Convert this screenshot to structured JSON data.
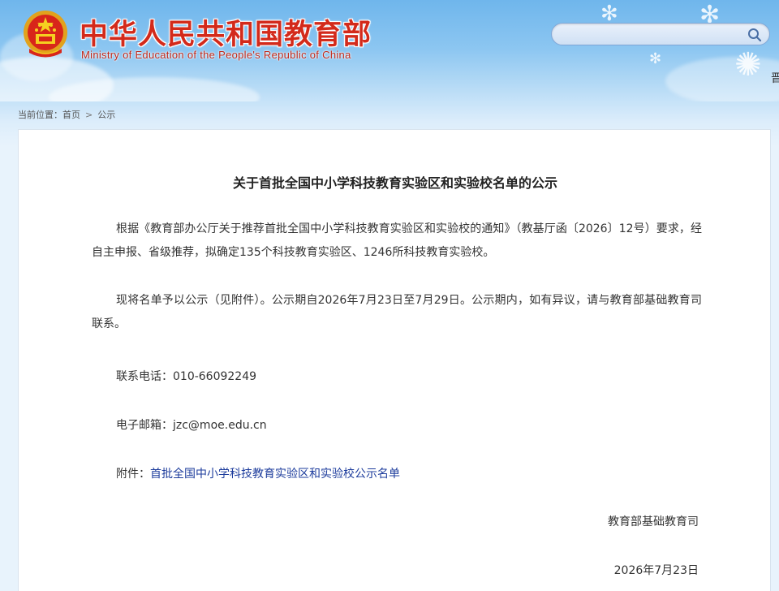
{
  "header": {
    "title_cn": "中华人民共和国教育部",
    "title_en": "Ministry of Education of the People's Republic of China",
    "search": {
      "placeholder": "",
      "value": ""
    },
    "edge_glyph": "晋"
  },
  "breadcrumb": {
    "prefix": "当前位置：",
    "items": [
      "首页",
      "公示"
    ],
    "separator": ">"
  },
  "article": {
    "title": "关于首批全国中小学科技教育实验区和实验校名单的公示",
    "paragraphs": [
      "根据《教育部办公厅关于推荐首批全国中小学科技教育实验区和实验校的通知》（教基厅函〔2026〕12号）要求，经自主申报、省级推荐，拟确定135个科技教育实验区、1246所科技教育实验校。",
      "现将名单予以公示（见附件）。公示期自2026年7月23日至7月29日。公示期内，如有异议，请与教育部基础教育司联系。"
    ],
    "contact_phone_label": "联系电话：",
    "contact_phone": "010-66092249",
    "email_label": "电子邮箱：",
    "email": "jzc@moe.edu.cn",
    "attachment_label": "附件：",
    "attachment_link": "首批全国中小学科技教育实验区和实验校公示名单",
    "signature": "教育部基础教育司",
    "date": "2026年7月23日"
  },
  "colors": {
    "title_red": "#d32a1b",
    "link_blue": "#1d3c9c",
    "sky_blue": "#6fb6ec"
  }
}
